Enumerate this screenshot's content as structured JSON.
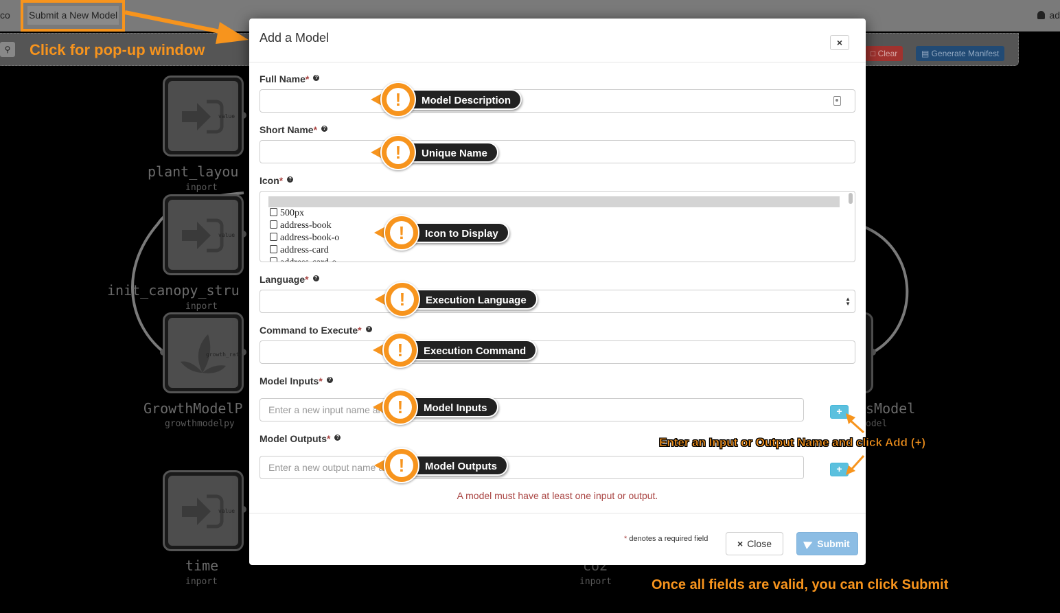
{
  "app": {
    "brand_fragment": "co",
    "submit_new_model": "Submit a New Model",
    "user_fragment": "ad",
    "search_icon": "search-icon",
    "clear_label": "Clear",
    "generate_manifest_label": "Generate Manifest"
  },
  "nodes": [
    {
      "title": "plant_layou",
      "type": "inport",
      "port": "value"
    },
    {
      "title": "init_canopy_stru",
      "type": "inport",
      "port": "value"
    },
    {
      "title": "GrowthModelP",
      "type": "growthmodelpy",
      "port_in": "",
      "port_out": "growth_rate"
    },
    {
      "title": "time",
      "type": "inport",
      "port": "value"
    },
    {
      "title": "co2",
      "type": "inport"
    },
    {
      "title": "sModel",
      "type": "odel"
    }
  ],
  "annotations": {
    "popup": "Click for pop-up window",
    "add": "Enter an Input or Output Name and click Add (+)",
    "submit": "Once all fields are valid, you can click Submit"
  },
  "modal": {
    "title": "Add a Model",
    "close_icon": "×",
    "required_mark": "*",
    "help_icon": "?",
    "fields": {
      "full_name": {
        "label": "Full Name",
        "value": "",
        "callout": "Model Description"
      },
      "short_name": {
        "label": "Short Name",
        "value": "",
        "callout": "Unique Name"
      },
      "icon": {
        "label": "Icon",
        "callout": "Icon to Display",
        "options": [
          "500px",
          "address-book",
          "address-book-o",
          "address-card",
          "address-card-o"
        ]
      },
      "language": {
        "label": "Language",
        "value": "",
        "callout": "Execution Language"
      },
      "command": {
        "label": "Command to Execute",
        "value": "",
        "callout": "Execution Command"
      },
      "inputs": {
        "label": "Model Inputs",
        "placeholder": "Enter a new input name and click + on the right...",
        "callout": "Model Inputs"
      },
      "outputs": {
        "label": "Model Outputs",
        "placeholder": "Enter a new output name and click + on the right...",
        "callout": "Model Outputs"
      }
    },
    "add_button_label": "+",
    "error": "A model must have at least one input or output.",
    "required_note": "denotes a required field",
    "close_label": "Close",
    "submit_label": "Submit"
  },
  "colors": {
    "annotation_orange": "#f7941d",
    "error_red": "#a94442",
    "info_blue": "#5bc0de",
    "submit_blue": "#8cbde4"
  }
}
